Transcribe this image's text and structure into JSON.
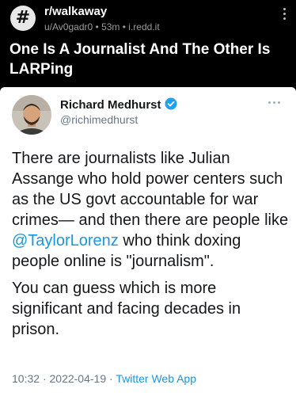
{
  "post": {
    "subreddit": "r/walkaway",
    "icon_glyph": "#",
    "author": "u/Av0gadr0",
    "separator": "•",
    "age": "53m",
    "domain": "i.redd.it",
    "title": "One Is A Journalist And The Other Is LARPing"
  },
  "tweet": {
    "name": "Richard Medhurst",
    "handle": "@richimedhurst",
    "p1_a": "There are journalists like Julian Assange who hold power centers such as the US govt accountable for war crimes— and then there are people like ",
    "mention": "@TaylorLorenz",
    "p1_b": " who think doxing people online is \"journalism\".",
    "p2": "You can guess which is more significant and facing decades in prison.",
    "time": "10:32",
    "dot": "·",
    "date": "2022-04-19",
    "app": "Twitter Web App"
  },
  "colors": {
    "link": "#1b95e0",
    "verified": "#1da1f2",
    "header_bg": "#000000",
    "card_bg": "#ffffff"
  },
  "icons": [
    "hashtag-icon",
    "kebab-menu-icon",
    "verified-badge-icon",
    "more-options-icon"
  ]
}
